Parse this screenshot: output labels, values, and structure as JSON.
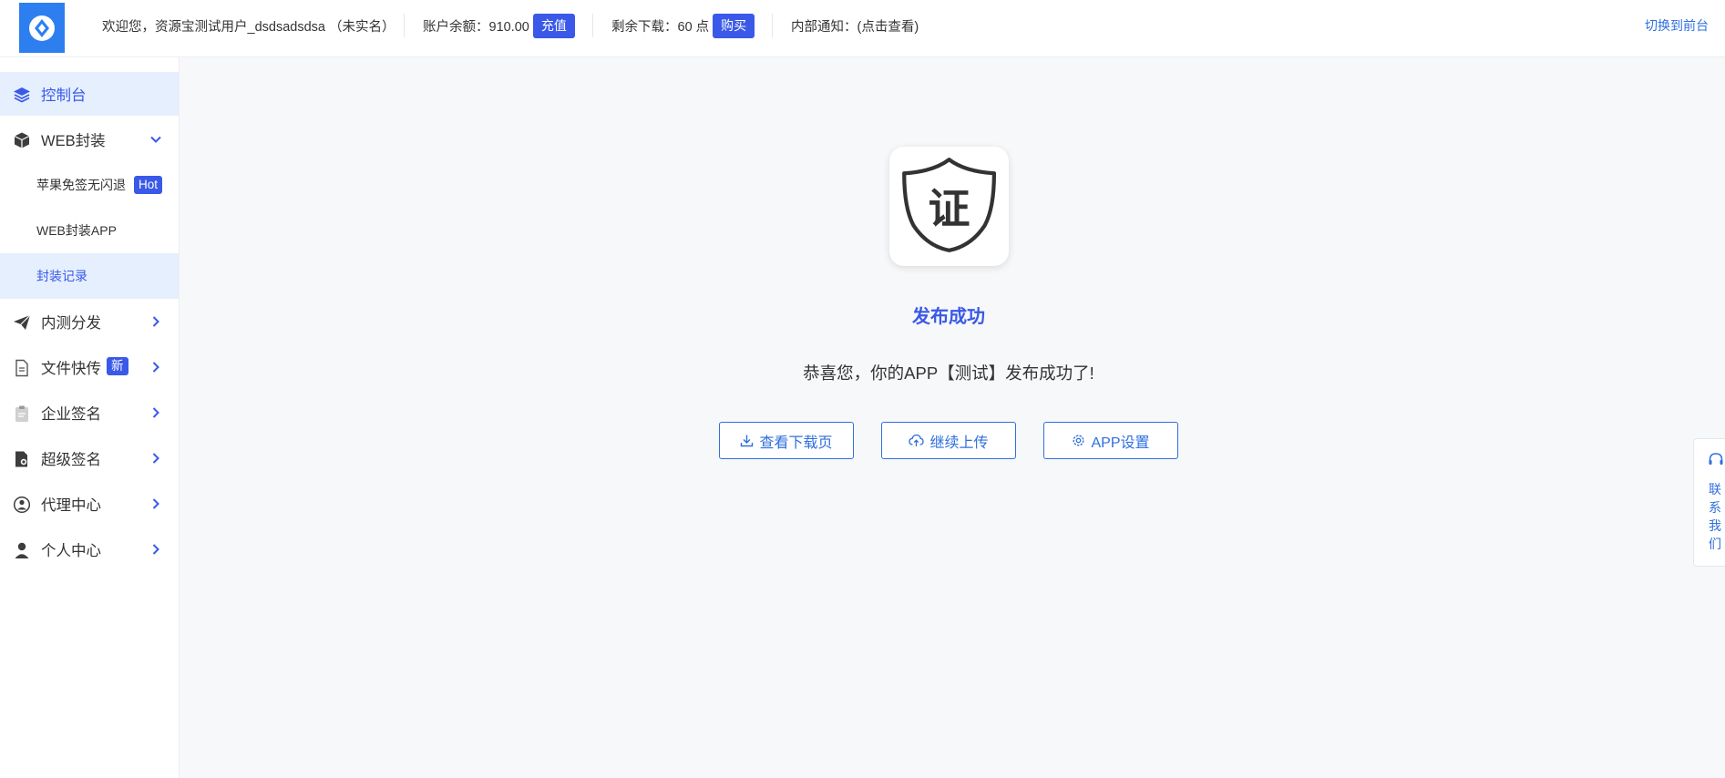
{
  "header": {
    "welcome": "欢迎您，资源宝测试用户_dsdsadsdsa （未实名）",
    "balance_label": "账户余额：910.00",
    "recharge_button": "充值",
    "downloads_label": "剩余下载：60 点",
    "buy_button": "购买",
    "notice": "内部通知：(点击查看)",
    "switch_front": "切换到前台"
  },
  "sidebar": {
    "items": [
      {
        "label": "控制台",
        "icon": "layers-icon"
      },
      {
        "label": "WEB封装",
        "icon": "box-icon"
      },
      {
        "label": "内测分发",
        "icon": "paper-plane-icon"
      },
      {
        "label": "文件快传",
        "icon": "file-transfer-icon",
        "tag": "新"
      },
      {
        "label": "企业签名",
        "icon": "clipboard-icon"
      },
      {
        "label": "超级签名",
        "icon": "certificate-icon"
      },
      {
        "label": "代理中心",
        "icon": "agent-icon"
      },
      {
        "label": "个人中心",
        "icon": "user-icon"
      }
    ],
    "web_sub": [
      {
        "label": "苹果免签无闪退",
        "tag": "Hot"
      },
      {
        "label": "WEB封装APP"
      },
      {
        "label": "封装记录"
      }
    ]
  },
  "main": {
    "app_icon_glyph": "证",
    "title": "发布成功",
    "message": "恭喜您，你的APP【测试】发布成功了!",
    "buttons": {
      "download_page": "查看下载页",
      "continue_upload": "继续上传",
      "app_settings": "APP设置"
    }
  },
  "contact": {
    "label": "联系我们"
  },
  "colors": {
    "accent": "#3a59e8",
    "link": "#2f6fde",
    "logo": "#2d7ff0"
  }
}
